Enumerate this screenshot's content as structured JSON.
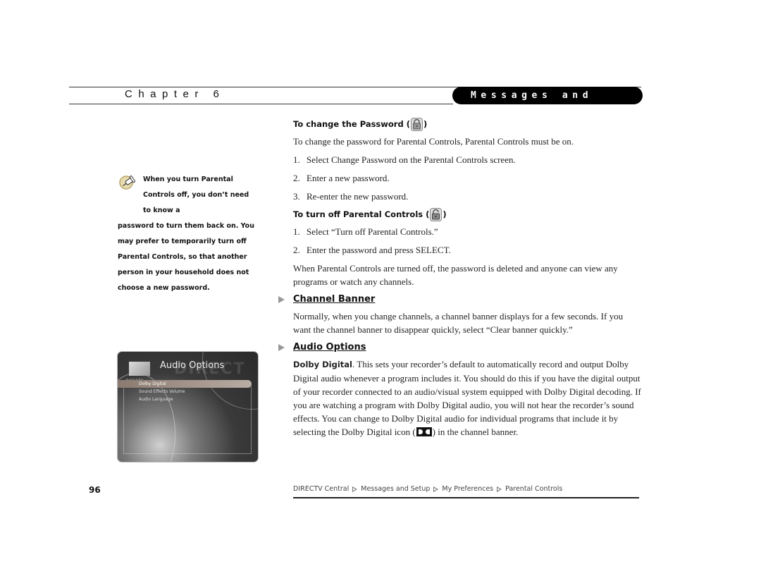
{
  "header": {
    "chapter": "Chapter 6",
    "section": "Messages and Setup"
  },
  "sidebar": {
    "tip_icon": "pushpin-icon",
    "note_first": "When you turn Parental Controls off, you don’t need to know a",
    "note_rest": "password to turn them back on. You may prefer to temporarily turn off Parental Controls, so that another person in your household does not choose a new password."
  },
  "screenshot": {
    "title": "Audio Options",
    "watermark": "DIRECT",
    "logo_text": "DIRECTV",
    "menu_items": [
      "Dolby Digital",
      "Sound Effects Volume",
      "Audio Language"
    ],
    "selected_index": 0
  },
  "main": {
    "change_password": {
      "heading_pre": "To change the Password (",
      "heading_post": ")",
      "icon": "lock-closed-icon",
      "intro": "To change the password for Parental Controls, Parental Controls must be on.",
      "steps": [
        {
          "num": "1.",
          "text": "Select Change Password on the Parental Controls screen."
        },
        {
          "num": "2.",
          "text": "Enter a new password."
        },
        {
          "num": "3.",
          "text": "Re-enter the new password."
        }
      ]
    },
    "turn_off": {
      "heading_pre": "To turn off Parental Controls (",
      "heading_post": ")",
      "icon": "lock-open-icon",
      "steps": [
        {
          "num": "1.",
          "text": "Select “Turn off Parental Controls.”"
        },
        {
          "num": "2.",
          "text": "Enter the password and press SELECT."
        }
      ],
      "outro": "When Parental Controls are turned off, the password is deleted and anyone can view any programs or watch any channels."
    },
    "channel_banner": {
      "heading": "Channel Banner",
      "text": "Normally, when you change channels, a channel banner displays for a few seconds. If you want the channel banner to disappear quickly, select “Clear banner quickly.”"
    },
    "audio_options": {
      "heading": "Audio Options",
      "term": "Dolby Digital",
      "text_pre": ". This sets your recorder’s default to automatically record and output Dolby Digital audio whenever a program includes it. You should do this if you have the digital output of your recorder connected to an audio/visual system equipped with Dolby Digital decoding. If you are watching a program with Dolby Digital audio, you will not hear the recorder’s sound effects. You can change to Dolby Digital audio for individual programs that include it by selecting the Dolby Digital icon (",
      "icon": "dolby-digital-icon",
      "text_post": ") in the channel banner."
    }
  },
  "footer": {
    "page_number": "96",
    "breadcrumb": [
      "DIRECTV Central",
      "Messages and Setup",
      "My Preferences",
      "Parental Controls"
    ]
  }
}
